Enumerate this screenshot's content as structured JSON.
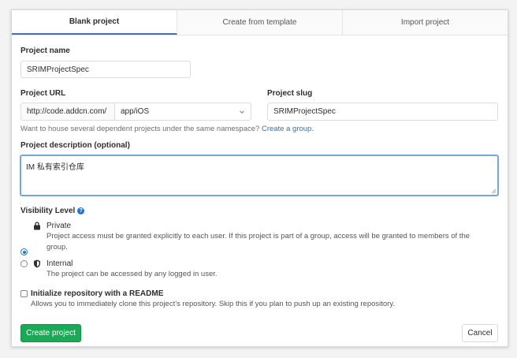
{
  "tabs": [
    {
      "label": "Blank project",
      "active": true
    },
    {
      "label": "Create from template",
      "active": false
    },
    {
      "label": "Import project",
      "active": false
    }
  ],
  "project_name": {
    "label": "Project name",
    "value": "SRIMProjectSpec"
  },
  "project_url": {
    "label": "Project URL",
    "prefix": "http://code.addcn.com/",
    "namespace": "app/iOS"
  },
  "project_slug": {
    "label": "Project slug",
    "value": "SRIMProjectSpec"
  },
  "namespace_hint": {
    "text": "Want to house several dependent projects under the same namespace?",
    "link": "Create a group."
  },
  "description": {
    "label": "Project description (optional)",
    "value": "IM 私有索引仓库"
  },
  "visibility": {
    "label": "Visibility Level",
    "help_glyph": "?",
    "options": [
      {
        "title": "Private",
        "icon": "lock-icon",
        "checked": true,
        "desc_line1": "Project access must be granted explicitly to each user. If this project is part of a group, access will be granted to members of the",
        "desc_line2": "group."
      },
      {
        "title": "Internal",
        "icon": "shield-icon",
        "checked": false,
        "desc_line1": "The project can be accessed by any logged in user."
      }
    ]
  },
  "readme": {
    "title": "Initialize repository with a README",
    "desc": "Allows you to immediately clone this project’s repository. Skip this if you plan to push up an existing repository.",
    "checked": false
  },
  "actions": {
    "create_label": "Create project",
    "cancel_label": "Cancel"
  },
  "colors": {
    "accent": "#1f78d1",
    "create_button": "#1aaa55",
    "active_tab_border": "#4b6cc1"
  }
}
